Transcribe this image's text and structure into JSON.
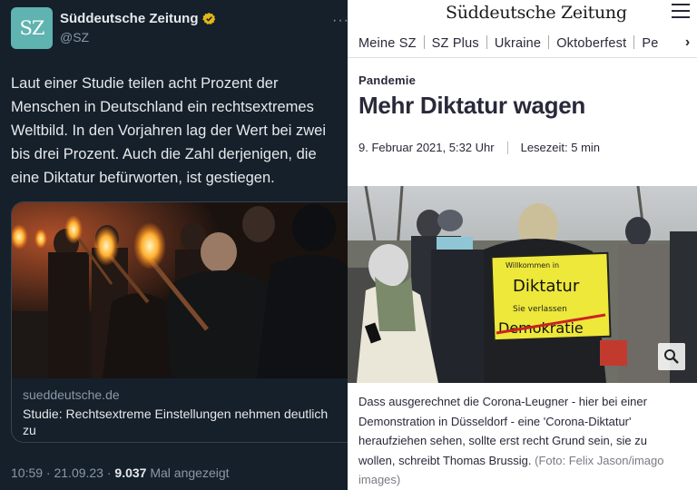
{
  "tweet": {
    "avatar_text": "SZ",
    "author": "Süddeutsche Zeitung",
    "handle": "@SZ",
    "more": "···",
    "text": "Laut einer Studie teilen acht Prozent der Menschen in Deutschland ein rechtsextremes Weltbild. In den Vorjahren lag der Wert bei zwei bis drei Prozent. Auch die Zahl derjenigen, die eine Diktatur befürworten, ist gestiegen.",
    "card": {
      "domain": "sueddeutsche.de",
      "title": "Studie: Rechtsextreme Einstellungen nehmen deutlich zu"
    },
    "time": "10:59 · 21.09.23 · ",
    "views": "9.037",
    "views_label": " Mal angezeigt",
    "colors": {
      "background": "#15202b",
      "verified": "#e2b719",
      "avatar": "#5fb3b0"
    }
  },
  "article": {
    "logo": "Süddeutsche Zeitung",
    "nav": [
      "Meine SZ",
      "SZ Plus",
      "Ukraine",
      "Oktoberfest",
      "Pe"
    ],
    "nav_arrow": "›",
    "kicker": "Pandemie",
    "headline": "Mehr Diktatur wagen",
    "date": "9. Februar 2021, 5:32 Uhr",
    "reading_time": "Lesezeit: 5 min",
    "sign": {
      "top": "Willkommen in",
      "main": "Diktatur",
      "middle": "Sie verlassen",
      "bottom": "Demokratie"
    },
    "caption": "Dass ausgerechnet die Corona-Leugner - hier bei einer Demonstration in Düsseldorf - eine 'Corona-Diktatur' heraufziehen sehen, sollte erst recht Grund sein, sie zu wollen, schreibt Thomas Brussig.",
    "credit": "(Foto: Felix Jason/imago images)",
    "icons": [
      "hamburger-menu-icon",
      "search-zoom-icon",
      "chevron-right-icon"
    ]
  }
}
